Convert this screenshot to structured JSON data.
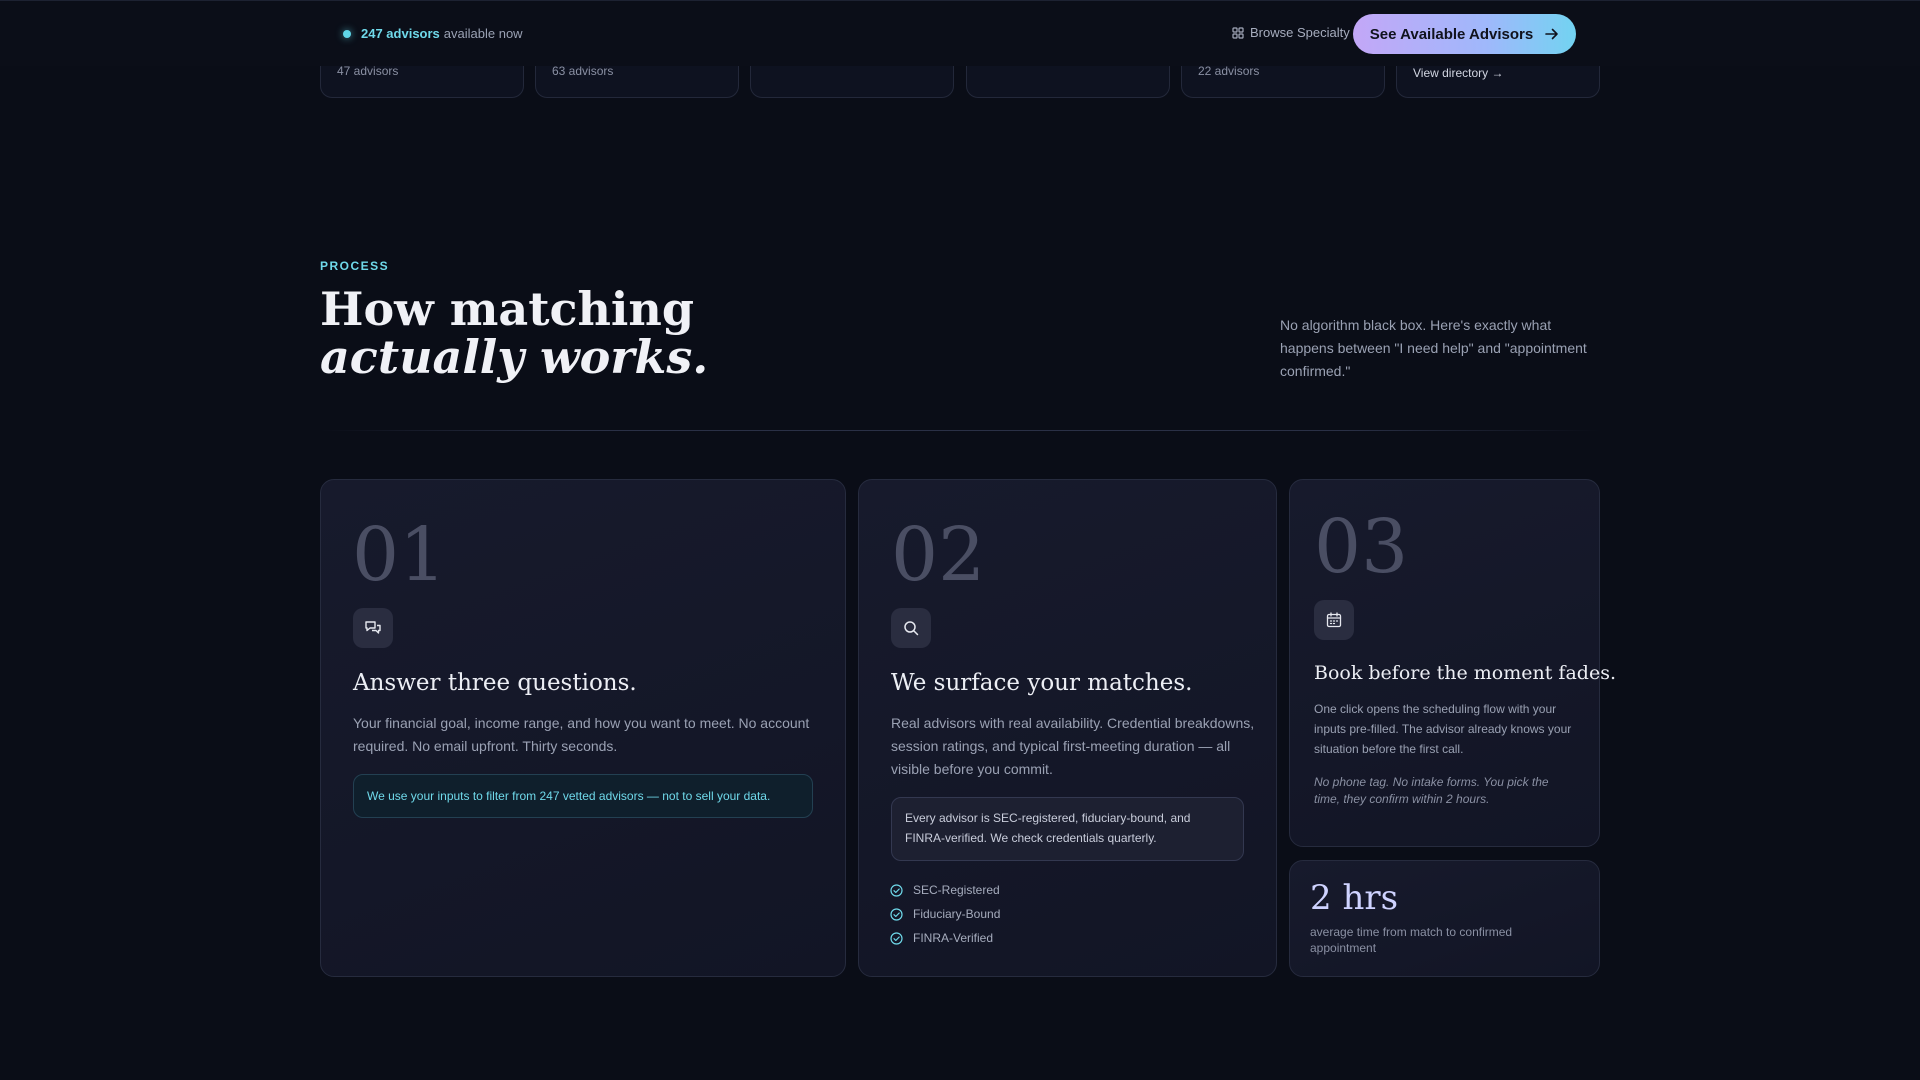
{
  "topbar": {
    "available_count": "247 advisors",
    "available_suffix": "available now",
    "browse_label": "Browse Specialty",
    "cta_label": "See Available Advisors"
  },
  "categories": [
    {
      "count": "47 advisors"
    },
    {
      "count": "63 advisors"
    },
    {
      "count": ""
    },
    {
      "count": ""
    },
    {
      "count": "22 advisors"
    },
    {
      "link": "View directory →"
    }
  ],
  "process": {
    "eyebrow": "PROCESS",
    "headline_line1": "How matching",
    "headline_line2": "actually works.",
    "intro": "No algorithm black box. Here's exactly what happens between \"I need help\" and \"appointment confirmed.\""
  },
  "steps": [
    {
      "num": "01",
      "icon": "chat-bubbles-icon",
      "title": "Answer three questions.",
      "body": "Your financial goal, income range, and how you want to meet. No account required. No email upfront. Thirty seconds.",
      "note": "We use your inputs to filter from 247 vetted advisors — not to sell your data."
    },
    {
      "num": "02",
      "icon": "search-icon",
      "title": "We surface your matches.",
      "body": "Real advisors with real availability. Credential breakdowns, session ratings, and typical first-meeting duration — all visible before you commit.",
      "note": "Every advisor is SEC-registered, fiduciary-bound, and FINRA-verified. We check credentials quarterly.",
      "checks": [
        "SEC-Registered",
        "Fiduciary-Bound",
        "FINRA-Verified"
      ]
    },
    {
      "num": "03",
      "icon": "calendar-icon",
      "title": "Book before the moment fades.",
      "body": "One click opens the scheduling flow with your inputs pre-filled. The advisor already knows your situation before the first call.",
      "note": "No phone tag. No intake forms. You pick the time, they confirm within 2 hours."
    }
  ],
  "stat": {
    "value": "2 hrs",
    "label": "average time from match to confirmed appointment"
  },
  "colors": {
    "accent_teal": "#6fd9ea",
    "background": "#0a0d17",
    "cta_gradient_start": "#c3a7f7",
    "cta_gradient_end": "#72d3f1"
  }
}
